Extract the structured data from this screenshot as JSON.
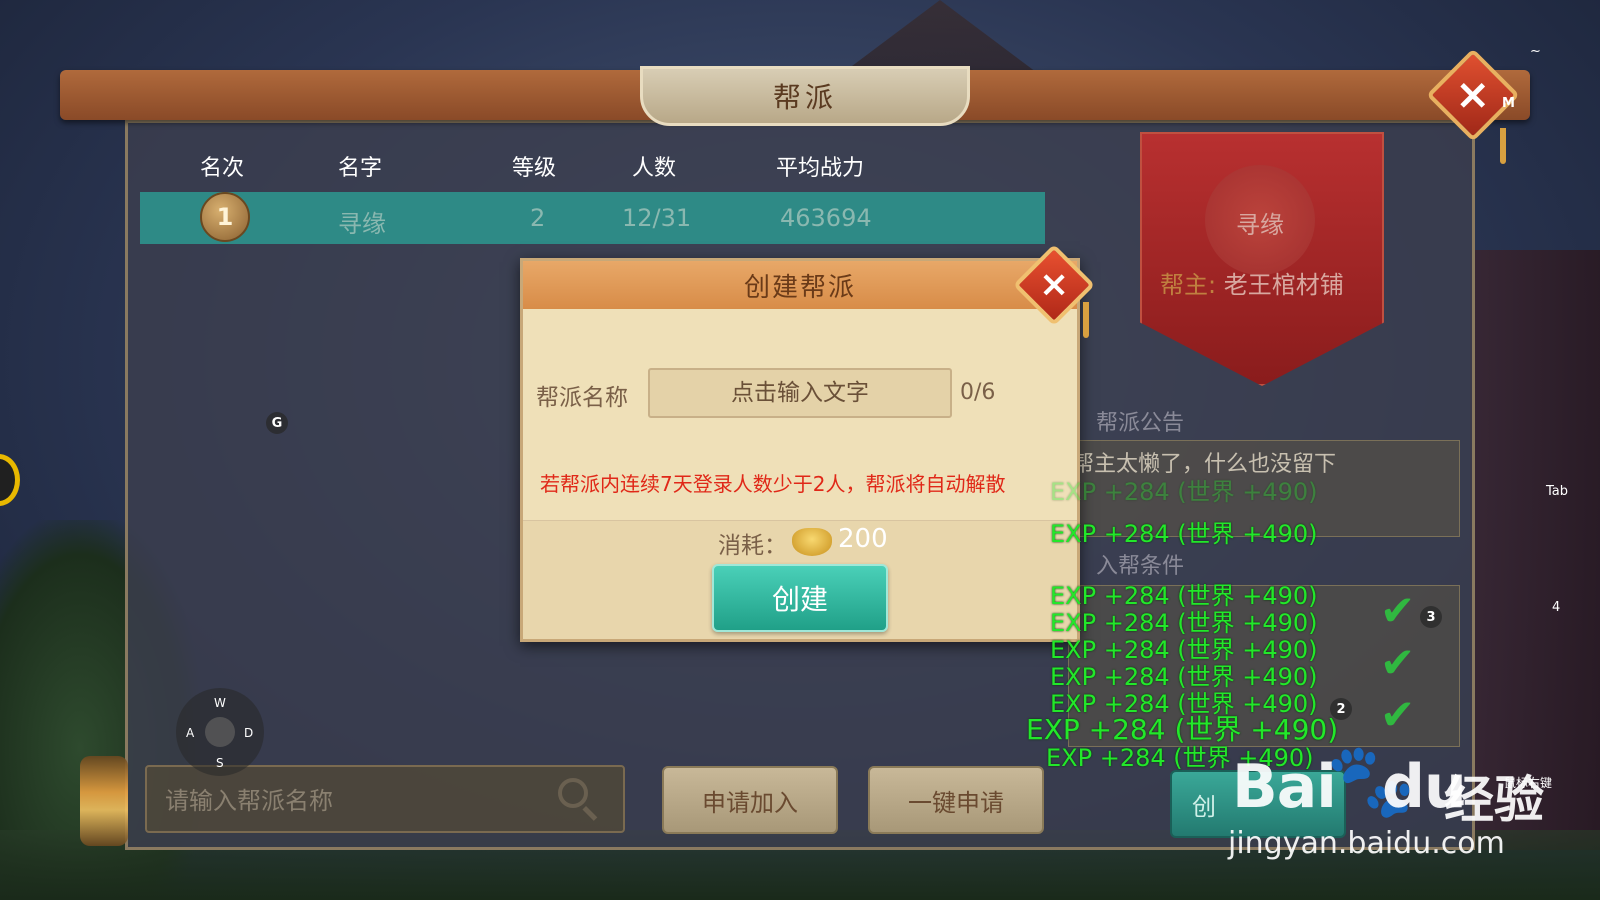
{
  "panel": {
    "title": "帮派",
    "close_icon": "close-icon"
  },
  "table": {
    "headers": [
      "名次",
      "名字",
      "等级",
      "人数",
      "平均战力"
    ],
    "rows": [
      {
        "rank": "1",
        "name": "寻缘",
        "level": "2",
        "members": "12/31",
        "power": "463694"
      }
    ]
  },
  "banner": {
    "guild_name": "寻缘",
    "leader_label": "帮主:",
    "leader_name": "老王棺材铺"
  },
  "sections": {
    "notice_title": "帮派公告",
    "notice_text": "帮主太懒了，什么也没留下",
    "conditions_title": "入帮条件"
  },
  "bottom": {
    "search_placeholder": "请输入帮派名称",
    "apply_label": "申请加入",
    "quick_apply_label": "一键申请",
    "create_label": "创"
  },
  "modal": {
    "title": "创建帮派",
    "field_label": "帮派名称",
    "input_placeholder": "点击输入文字",
    "char_count": "0/6",
    "warning": "若帮派内连续7天登录人数少于2人，帮派将自动解散",
    "cost_label": "消耗：",
    "cost_value": "200",
    "create_button": "创建"
  },
  "exp_messages": [
    "EXP +284 (世界 +490)",
    "EXP +284 (世界 +490)",
    "EXP +284 (世界 +490)",
    "EXP +284 (世界 +490)",
    "EXP +284 (世界 +490)",
    "EXP +284 (世界 +490)",
    "EXP +284 (世界 +490)",
    "EXP +284 (世界 +490)",
    "EXP +284 (世界 +490)"
  ],
  "key_overlay": {
    "g": "G",
    "m": "M",
    "tab": "Tab",
    "four": "4",
    "three": "3",
    "two": "2",
    "tilde": "~",
    "right_mouse": "鼠标右键",
    "w": "W",
    "a": "A",
    "s": "S",
    "d": "D"
  },
  "watermark": {
    "logo": "Bai",
    "logo2": "du",
    "cn": "经验",
    "url": "jingyan.baidu.com"
  },
  "colors": {
    "accent_teal": "#2e8a86",
    "warning_red": "#e02818",
    "exp_green": "#22e82a"
  }
}
